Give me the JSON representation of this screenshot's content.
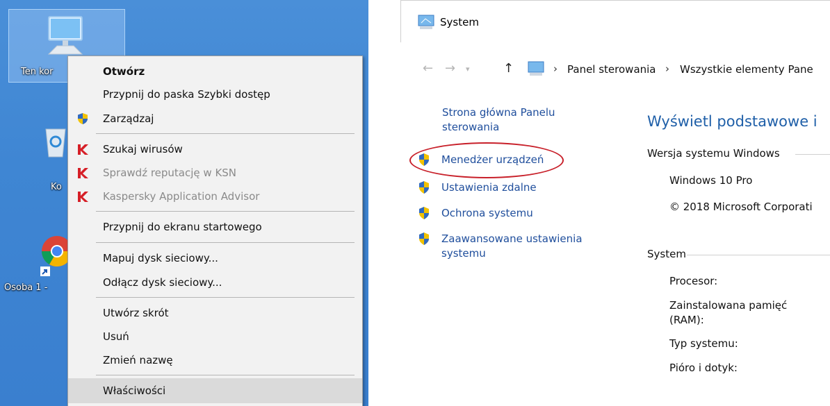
{
  "desktop": {
    "icons": [
      {
        "icon": "computer-icon",
        "label": "Ten kor"
      },
      {
        "icon": "recycle-bin-icon",
        "label": "Ko"
      },
      {
        "icon": "chrome-icon",
        "label": "Osoba 1 -"
      }
    ]
  },
  "context_menu": {
    "items": [
      {
        "label": "Otwórz",
        "bold": true
      },
      {
        "label": "Przypnij do paska Szybki dostęp"
      },
      {
        "label": "Zarządzaj",
        "icon": "uac-shield-icon"
      },
      {
        "label": "Szukaj wirusów",
        "icon": "kaspersky-icon"
      },
      {
        "label": "Sprawdź reputację w KSN",
        "icon": "kaspersky-icon",
        "disabled": true
      },
      {
        "label": "Kaspersky Application Advisor",
        "icon": "kaspersky-icon",
        "disabled": true
      },
      {
        "label": "Przypnij do ekranu startowego"
      },
      {
        "label": "Mapuj dysk sieciowy..."
      },
      {
        "label": "Odłącz dysk sieciowy..."
      },
      {
        "label": "Utwórz skrót"
      },
      {
        "label": "Usuń"
      },
      {
        "label": "Zmień nazwę"
      },
      {
        "label": "Właściwości",
        "highlighted": true
      }
    ]
  },
  "system_window": {
    "title": "System",
    "breadcrumb": [
      "Panel sterowania",
      "Wszystkie elementy Pane"
    ],
    "sidebar": {
      "home_link": [
        "Strona główna Panelu",
        "sterowania"
      ],
      "links": [
        {
          "label": [
            "Menedżer urządzeń"
          ],
          "icon": "uac-shield-icon",
          "circled": true
        },
        {
          "label": [
            "Ustawienia zdalne"
          ],
          "icon": "uac-shield-icon"
        },
        {
          "label": [
            "Ochrona systemu"
          ],
          "icon": "uac-shield-icon"
        },
        {
          "label": [
            "Zaawansowane ustawienia",
            "systemu"
          ],
          "icon": "uac-shield-icon"
        }
      ]
    },
    "main": {
      "heading": "Wyświetl podstawowe i",
      "edition_group": "Wersja systemu Windows",
      "edition": "Windows 10 Pro",
      "copyright": "© 2018 Microsoft Corporati",
      "system_group": "System",
      "processor_label": "Procesor:",
      "ram_label": [
        "Zainstalowana pamięć",
        "(RAM):"
      ],
      "system_type_label": "Typ systemu:",
      "pen_touch_label": "Pióro i dotyk:"
    }
  },
  "colors": {
    "desktop_bg": "#3f86d3",
    "menu_bg": "#f2f2f2",
    "link": "#1f4e9c",
    "heading": "#1f5fa8",
    "annotation_ring": "#c8202a"
  }
}
